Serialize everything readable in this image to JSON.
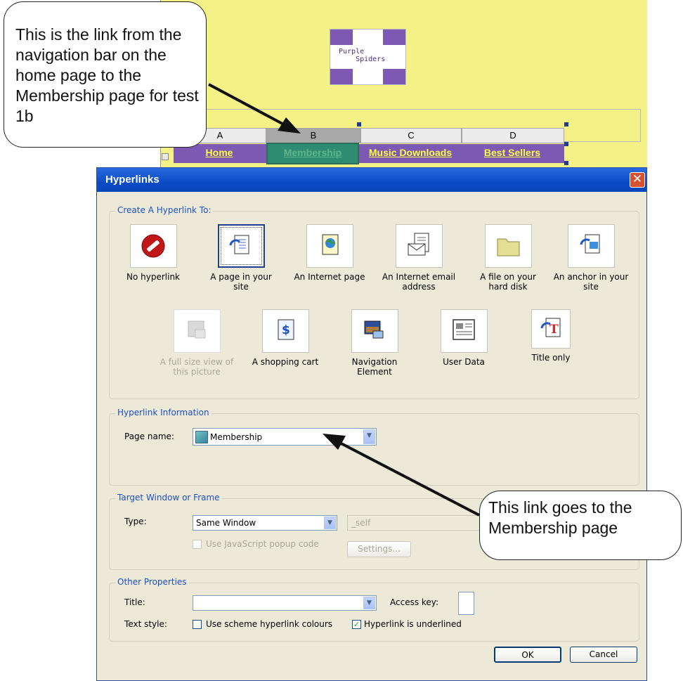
{
  "editor": {
    "logo_text": "Purple\n    Spiders",
    "columns": [
      "A",
      "B",
      "C",
      "D"
    ],
    "nav_links": [
      "Home",
      "Membership",
      "Music Downloads",
      "Best Sellers"
    ]
  },
  "callouts": {
    "top_left": "This is the link from the navigation bar on the home page to the Membership page for test 1b",
    "bottom_right": "This link goes to the Membership page"
  },
  "dialog": {
    "title": "Hyperlinks",
    "close_glyph": "✕",
    "create_group": {
      "title": "Create A Hyperlink To:",
      "options": [
        {
          "label": "No hyperlink",
          "icon": "no-entry-icon"
        },
        {
          "label": "A page in your site",
          "icon": "site-page-icon"
        },
        {
          "label": "An Internet page",
          "icon": "internet-page-icon"
        },
        {
          "label": "An Internet email address",
          "icon": "email-icon"
        },
        {
          "label": "A file on your hard disk",
          "icon": "folder-icon"
        },
        {
          "label": "An anchor in your site",
          "icon": "anchor-icon"
        },
        {
          "label": "A full size view of this picture",
          "icon": "picture-icon"
        },
        {
          "label": "A shopping cart",
          "icon": "shopping-cart-icon"
        },
        {
          "label": "Navigation Element",
          "icon": "navigation-icon"
        },
        {
          "label": "User Data",
          "icon": "user-data-icon"
        },
        {
          "label": "Title only",
          "icon": "title-icon"
        }
      ]
    },
    "info_group": {
      "title": "Hyperlink Information",
      "page_name_label": "Page name:",
      "page_name_value": "Membership"
    },
    "target_group": {
      "title": "Target Window or Frame",
      "type_label": "Type:",
      "type_value": "Same Window",
      "target_value": "_self",
      "popup_label": "Use JavaScript popup code",
      "settings_label": "Settings..."
    },
    "other_group": {
      "title": "Other Properties",
      "title_label": "Title:",
      "title_value": "",
      "access_key_label": "Access key:",
      "text_style_label": "Text style:",
      "scheme_colours_label": "Use scheme hyperlink colours",
      "underlined_label": "Hyperlink is underlined"
    },
    "ok_label": "OK",
    "cancel_label": "Cancel"
  }
}
